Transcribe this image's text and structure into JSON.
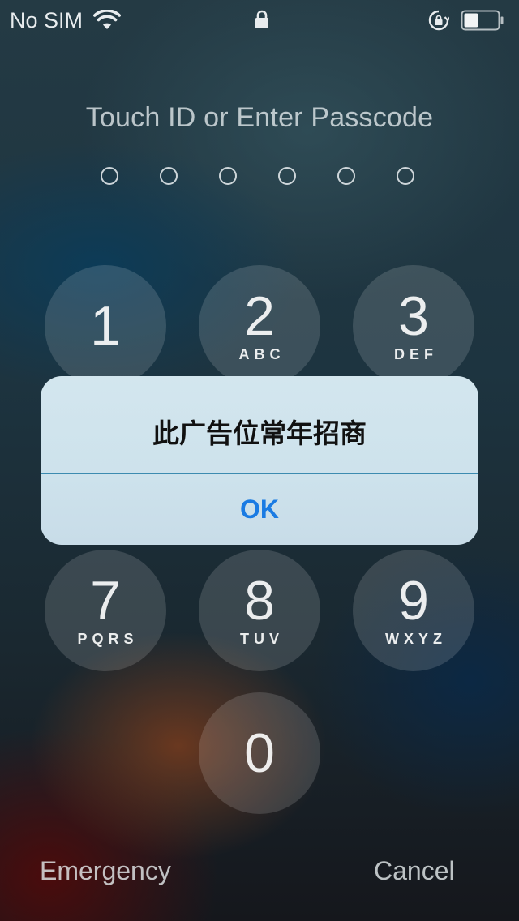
{
  "status_bar": {
    "carrier": "No SIM",
    "wifi_icon": "wifi-icon",
    "lock_icon": "lock-icon",
    "rotation_lock_icon": "rotation-lock-icon",
    "battery_icon": "battery-icon"
  },
  "title": "Touch ID or Enter Passcode",
  "passcode_length": 6,
  "keypad": [
    {
      "digit": "1",
      "letters": ""
    },
    {
      "digit": "2",
      "letters": "ABC"
    },
    {
      "digit": "3",
      "letters": "DEF"
    },
    {
      "digit": "7",
      "letters": "PQRS"
    },
    {
      "digit": "8",
      "letters": "TUV"
    },
    {
      "digit": "9",
      "letters": "WXYZ"
    },
    {
      "digit": "0",
      "letters": ""
    }
  ],
  "alert": {
    "message": "此广告位常年招商",
    "ok_label": "OK"
  },
  "bottom": {
    "emergency_label": "Emergency",
    "cancel_label": "Cancel"
  },
  "colors": {
    "alert_button": "#1a7be3",
    "alert_background": "#cde2ec"
  }
}
